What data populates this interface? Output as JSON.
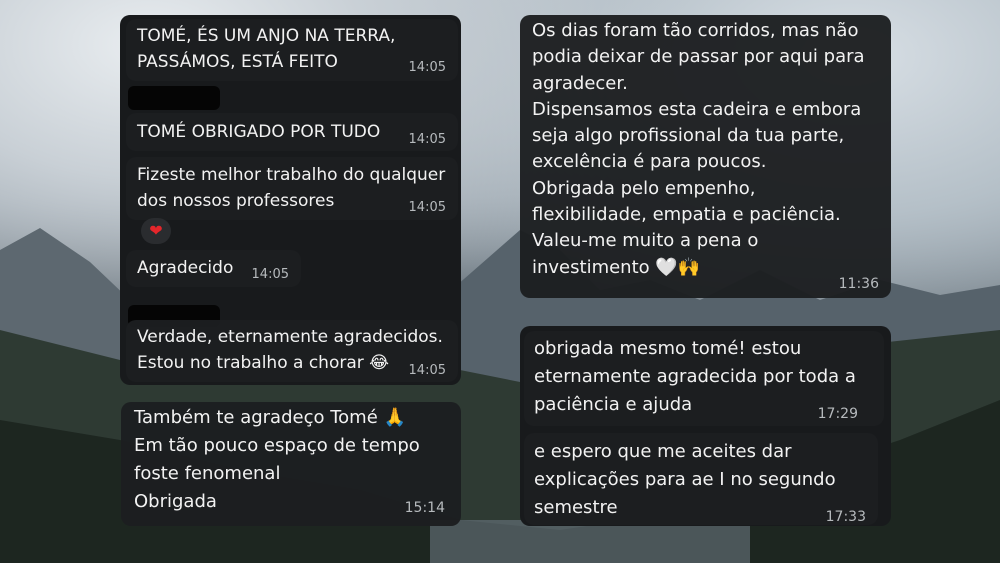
{
  "left_chat": {
    "messages": [
      {
        "text": "TOMÉ, ÉS UM ANJO NA TERRA,\nPASSÁMOS, ESTÁ FEITO",
        "time": "14:05"
      },
      {
        "text": "TOMÉ OBRIGADO POR TUDO",
        "time": "14:05"
      },
      {
        "text": "Fizeste melhor trabalho do qualquer\ndos nossos professores",
        "time": "14:05",
        "reaction": "❤"
      },
      {
        "text": "Agradecido",
        "time": "14:05"
      },
      {
        "text": "Verdade, eternamente agradecidos.\nEstou no trabalho a chorar 😂",
        "time": "14:05"
      }
    ]
  },
  "left_bottom": {
    "text": "Também te agradeço Tomé 🙏\nEm tão pouco espaço de tempo\nfoste fenomenal\nObrigada",
    "time": "15:14"
  },
  "right_top": {
    "text": "Os dias foram tão corridos, mas não\npodia deixar de passar por aqui para\nagradecer.\nDispensamos esta cadeira e embora\nseja algo profissional da tua parte,\nexcelência é para poucos.\nObrigada pelo empenho,\nflexibilidade, empatia e paciência.\nValeu-me muito a pena o\ninvestimento 🤍🙌",
    "time": "11:36"
  },
  "right_bottom": {
    "messages": [
      {
        "text": "obrigada mesmo tomé! estou\neternamente agradecida por toda a\npaciência e ajuda",
        "time": "17:29"
      },
      {
        "text": "e espero que me aceites dar\nexplicações para ae I no segundo\nsemestre",
        "time": "17:33"
      }
    ]
  }
}
